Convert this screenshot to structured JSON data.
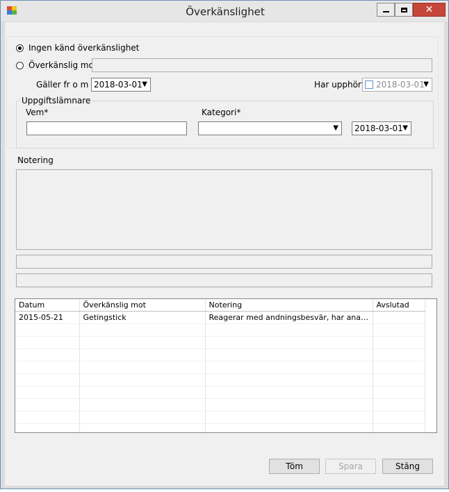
{
  "window": {
    "title": "Överkänslighet"
  },
  "allergy": {
    "radio_none_label": "Ingen känd överkänslighet",
    "radio_allergic_label": "Överkänslig mot*",
    "allergic_to_value": "",
    "valid_from_label": "Gäller fr o m",
    "valid_from_value": "2018-03-01",
    "ended_label": "Har upphört",
    "ended_value": "2018-03-01"
  },
  "informant": {
    "group_title": "Uppgiftslämnare",
    "who_label": "Vem*",
    "who_value": "",
    "category_label": "Kategori*",
    "category_value": "",
    "date_value": "2018-03-01"
  },
  "note": {
    "label": "Notering",
    "value": ""
  },
  "table": {
    "columns": [
      "Datum",
      "Överkänslig mot",
      "Notering",
      "Avslutad"
    ],
    "rows": [
      [
        "2015-05-21",
        "Getingstick",
        "Reagerar med andningsbesvär, har anapen med sig",
        ""
      ]
    ]
  },
  "buttons": {
    "clear": "Töm",
    "save": "Spara",
    "close": "Stäng"
  },
  "colors": {
    "close_button": "#c7463a",
    "window_border": "#6c8fb6"
  }
}
